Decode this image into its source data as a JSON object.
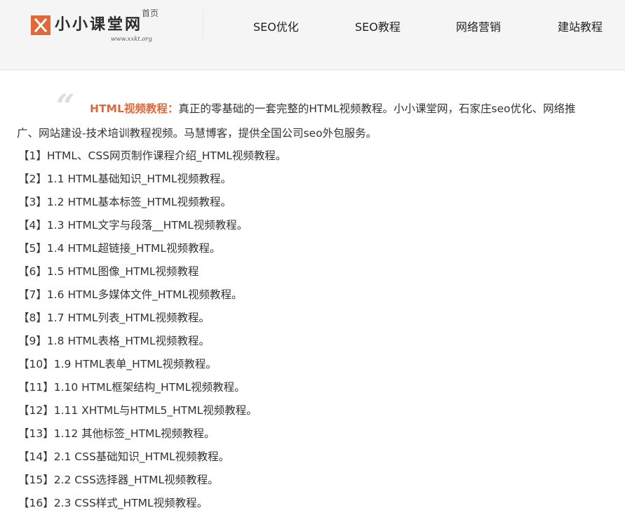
{
  "logo": {
    "name": "小小课堂网",
    "home_label": "首页",
    "url_text": "www.xxkt.org"
  },
  "nav": [
    {
      "label": "SEO优化"
    },
    {
      "label": "SEO教程"
    },
    {
      "label": "网络营销"
    },
    {
      "label": "建站教程"
    }
  ],
  "article": {
    "intro_highlight": "HTML视频教程：",
    "intro_text": "真正的零基础的一套完整的HTML视频教程。小小课堂网，石家庄seo优化、网络推广、网站建设-技术培训教程视频。马慧博客，提供全国公司seo外包服务。",
    "items": [
      "【1】HTML、CSS网页制作课程介绍_HTML视频教程。",
      "【2】1.1 HTML基础知识_HTML视频教程。",
      "【3】1.2 HTML基本标签_HTML视频教程。",
      "【4】1.3 HTML文字与段落__HTML视频教程。",
      "【5】1.4 HTML超链接_HTML视频教程。",
      "【6】1.5 HTML图像_HTML视频教程",
      "【7】1.6 HTML多媒体文件_HTML视频教程。",
      "【8】1.7 HTML列表_HTML视频教程。",
      "【9】1.8 HTML表格_HTML视频教程。",
      "【10】1.9 HTML表单_HTML视频教程。",
      "【11】1.10 HTML框架结构_HTML视频教程。",
      "【12】1.11 XHTML与HTML5_HTML视频教程。",
      "【13】1.12 其他标签_HTML视频教程。",
      "【14】2.1 CSS基础知识_HTML视频教程。",
      "【15】2.2 CSS选择器_HTML视频教程。",
      "【16】2.3 CSS样式_HTML视频教程。"
    ]
  },
  "colors": {
    "accent": "#e0693c",
    "header_bg": "#f5f5f5",
    "text": "#333333"
  },
  "icons": {
    "logo_mark": "x-logo-icon",
    "quote": "quote-icon"
  }
}
